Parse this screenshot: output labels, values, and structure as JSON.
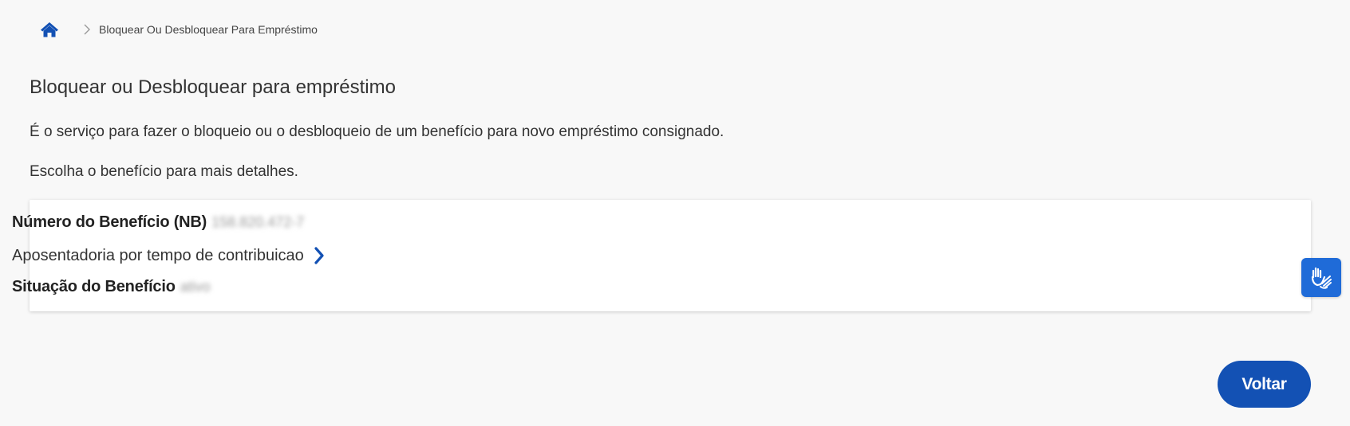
{
  "breadcrumb": {
    "home_icon": "home-icon",
    "separator_icon": "chevron-right-icon",
    "current": "Bloquear Ou Desbloquear Para Empréstimo"
  },
  "page": {
    "title": "Bloquear ou Desbloquear para empréstimo",
    "description": "É o serviço para fazer o bloqueio ou o desbloqueio de um benefício para novo empréstimo consignado.",
    "hint": "Escolha o benefício para mais detalhes."
  },
  "benefit_card": {
    "nb_label": "Número do Benefício (NB)",
    "nb_value": "158.820.472-7",
    "type": "Aposentadoria por tempo de contribuicao",
    "status_label": "Situação do Benefício",
    "status_value": "ativo",
    "open_icon": "chevron-right-icon"
  },
  "accessibility": {
    "libras_icon": "sign-language-hands-icon"
  },
  "actions": {
    "back_label": "Voltar"
  },
  "colors": {
    "primary": "#1351b4",
    "libras": "#1f6bd8",
    "background": "#f8f8f8",
    "text": "#333333"
  }
}
